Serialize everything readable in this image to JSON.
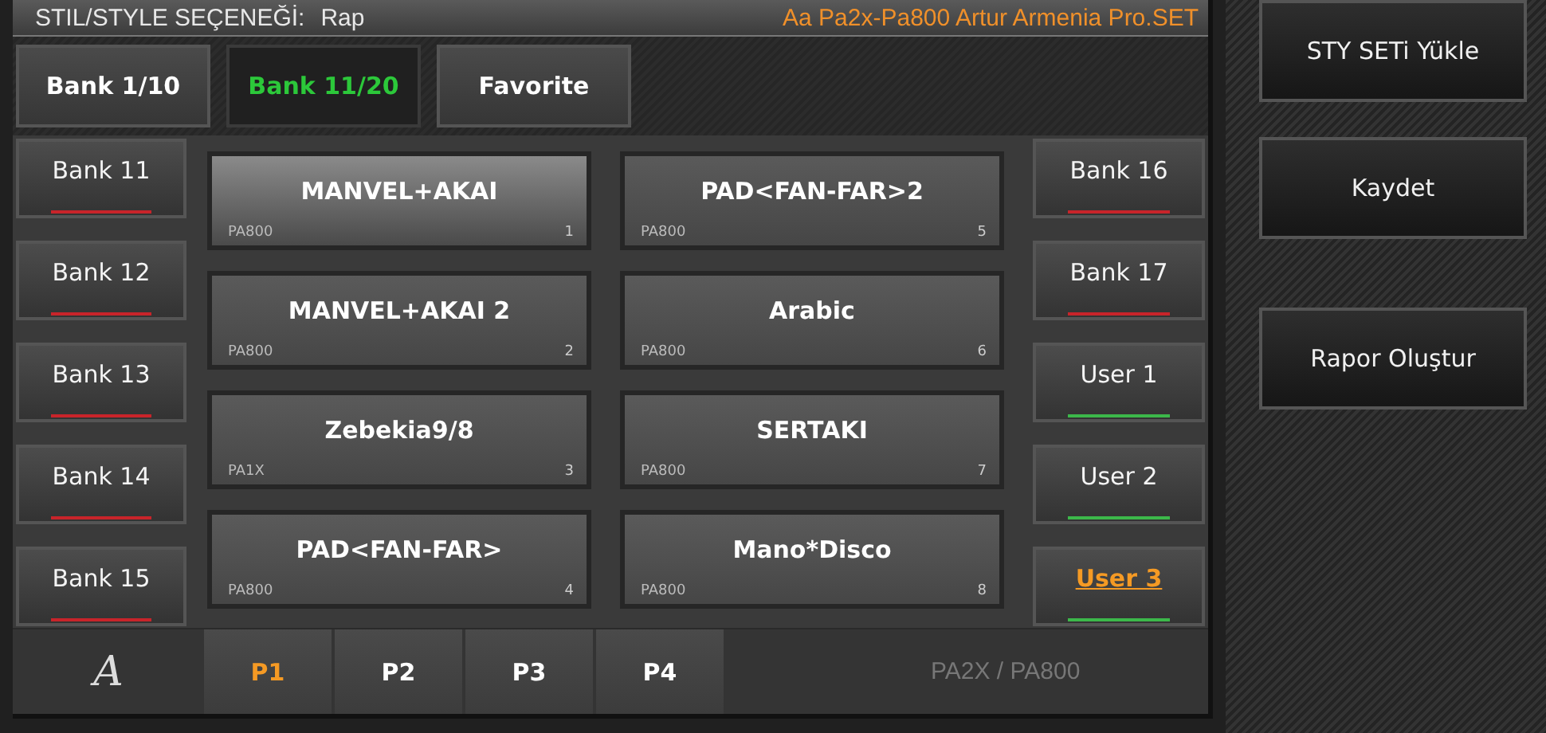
{
  "header": {
    "label": "STIL/STYLE SEÇENEĞİ:",
    "style": "Rap",
    "set_name": "Aa Pa2x-Pa800 Artur Armenia Pro.SET"
  },
  "bank_tabs": [
    {
      "label": "Bank 1/10",
      "selected": false
    },
    {
      "label": "Bank 11/20",
      "selected": true
    },
    {
      "label": "Favorite",
      "selected": false
    }
  ],
  "left_banks": [
    {
      "label": "Bank 11",
      "selected": false,
      "color": "#c8242a"
    },
    {
      "label": "Bank 12",
      "selected": false,
      "color": "#c8242a"
    },
    {
      "label": "Bank 13",
      "selected": false,
      "color": "#c8242a"
    },
    {
      "label": "Bank 14",
      "selected": false,
      "color": "#c8242a"
    },
    {
      "label": "Bank 15",
      "selected": false,
      "color": "#c8242a"
    }
  ],
  "right_banks": [
    {
      "label": "Bank 16",
      "selected": false,
      "color": "#c8242a"
    },
    {
      "label": "Bank 17",
      "selected": false,
      "color": "#c8242a"
    },
    {
      "label": "User 1",
      "selected": false,
      "color": "#3cb84a"
    },
    {
      "label": "User 2",
      "selected": false,
      "color": "#3cb84a"
    },
    {
      "label": "User 3",
      "selected": true,
      "color": "#3cb84a"
    }
  ],
  "styles": [
    {
      "name": "MANVEL+AKAI",
      "model": "PA800",
      "number": "1",
      "selected": true
    },
    {
      "name": "MANVEL+AKAI  2",
      "model": "PA800",
      "number": "2",
      "selected": false
    },
    {
      "name": "Zebekia9/8",
      "model": "PA1X",
      "number": "3",
      "selected": false
    },
    {
      "name": "PAD<FAN-FAR>",
      "model": "PA800",
      "number": "4",
      "selected": false
    },
    {
      "name": "PAD<FAN-FAR>2",
      "model": "PA800",
      "number": "5",
      "selected": false
    },
    {
      "name": "Arabic",
      "model": "PA800",
      "number": "6",
      "selected": false
    },
    {
      "name": "SERTAKI",
      "model": "PA800",
      "number": "7",
      "selected": false
    },
    {
      "name": "Mano*Disco",
      "model": "PA800",
      "number": "8",
      "selected": false
    }
  ],
  "bottom_bar": {
    "logo": "A",
    "pages": [
      {
        "label": "P1",
        "selected": true
      },
      {
        "label": "P2",
        "selected": false
      },
      {
        "label": "P3",
        "selected": false
      },
      {
        "label": "P4",
        "selected": false
      }
    ],
    "model_text": "PA2X / PA800"
  },
  "side_buttons": [
    "STY  SETi  Yükle",
    "Kaydet",
    "Rapor Oluştur"
  ]
}
